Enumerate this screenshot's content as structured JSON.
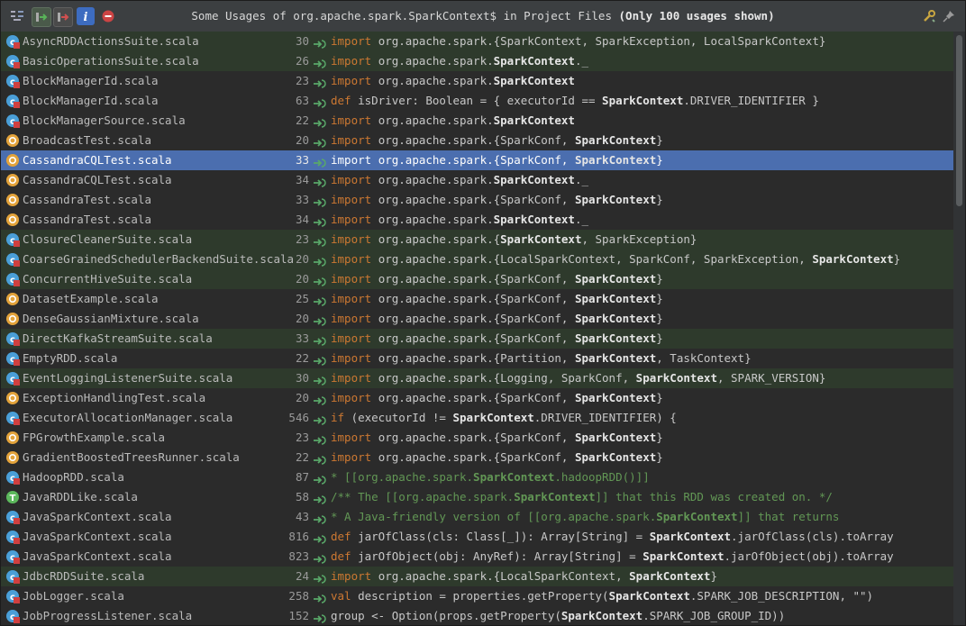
{
  "title": {
    "prefix": "Some Usages of org.apache.spark.SparkContext$ in Project Files ",
    "suffix": "(Only 100 usages shown)"
  },
  "toolbar": {
    "buttons": [
      {
        "name": "merge-usages-icon",
        "icon": "merge"
      },
      {
        "name": "next-occurrence-icon",
        "icon": "arrow-right-green"
      },
      {
        "name": "previous-occurrence-icon",
        "icon": "arrow-right-red"
      },
      {
        "name": "info-icon",
        "icon": "info"
      },
      {
        "name": "close-icon",
        "icon": "stop"
      }
    ],
    "right": [
      {
        "name": "settings-icon",
        "icon": "wrench"
      },
      {
        "name": "pin-icon",
        "icon": "pin"
      }
    ]
  },
  "rows": [
    {
      "file": "AsyncRDDActionsSuite.scala",
      "line": "30",
      "type": "class",
      "test": true,
      "code": [
        [
          "kw",
          "import "
        ],
        [
          "",
          "org.apache.spark.{SparkContext, SparkException, LocalSparkContext}"
        ]
      ]
    },
    {
      "file": "BasicOperationsSuite.scala",
      "line": "26",
      "type": "class",
      "test": true,
      "code": [
        [
          "kw",
          "import "
        ],
        [
          "",
          "org.apache.spark."
        ],
        [
          "hl",
          "SparkContext"
        ],
        [
          "",
          "._"
        ]
      ]
    },
    {
      "file": "BlockManagerId.scala",
      "line": "23",
      "type": "class",
      "code": [
        [
          "kw",
          "import "
        ],
        [
          "",
          "org.apache.spark."
        ],
        [
          "hl",
          "SparkContext"
        ]
      ]
    },
    {
      "file": "BlockManagerId.scala",
      "line": "63",
      "type": "class",
      "code": [
        [
          "kw",
          "def "
        ],
        [
          "",
          "isDriver: Boolean = { executorId == "
        ],
        [
          "hl",
          "SparkContext"
        ],
        [
          "",
          ".DRIVER_IDENTIFIER }"
        ]
      ]
    },
    {
      "file": "BlockManagerSource.scala",
      "line": "22",
      "type": "class",
      "code": [
        [
          "kw",
          "import "
        ],
        [
          "",
          "org.apache.spark."
        ],
        [
          "hl",
          "SparkContext"
        ]
      ]
    },
    {
      "file": "BroadcastTest.scala",
      "line": "20",
      "type": "object",
      "code": [
        [
          "kw",
          "import "
        ],
        [
          "",
          "org.apache.spark.{SparkConf, "
        ],
        [
          "hl",
          "SparkContext"
        ],
        [
          "",
          "}"
        ]
      ]
    },
    {
      "file": "CassandraCQLTest.scala",
      "line": "33",
      "type": "object",
      "selected": true,
      "code": [
        [
          "kw",
          "import "
        ],
        [
          "",
          "org.apache.spark.{SparkConf, "
        ],
        [
          "hl",
          "SparkContext"
        ],
        [
          "",
          "}"
        ]
      ]
    },
    {
      "file": "CassandraCQLTest.scala",
      "line": "34",
      "type": "object",
      "code": [
        [
          "kw",
          "import "
        ],
        [
          "",
          "org.apache.spark."
        ],
        [
          "hl",
          "SparkContext"
        ],
        [
          "",
          "._"
        ]
      ]
    },
    {
      "file": "CassandraTest.scala",
      "line": "33",
      "type": "object",
      "code": [
        [
          "kw",
          "import "
        ],
        [
          "",
          "org.apache.spark.{SparkConf, "
        ],
        [
          "hl",
          "SparkContext"
        ],
        [
          "",
          "}"
        ]
      ]
    },
    {
      "file": "CassandraTest.scala",
      "line": "34",
      "type": "object",
      "code": [
        [
          "kw",
          "import "
        ],
        [
          "",
          "org.apache.spark."
        ],
        [
          "hl",
          "SparkContext"
        ],
        [
          "",
          "._"
        ]
      ]
    },
    {
      "file": "ClosureCleanerSuite.scala",
      "line": "23",
      "type": "class",
      "test": true,
      "code": [
        [
          "kw",
          "import "
        ],
        [
          "",
          "org.apache.spark.{"
        ],
        [
          "hl",
          "SparkContext"
        ],
        [
          "",
          ", SparkException}"
        ]
      ]
    },
    {
      "file": "CoarseGrainedSchedulerBackendSuite.scala",
      "line": "20",
      "type": "class",
      "test": true,
      "code": [
        [
          "kw",
          "import "
        ],
        [
          "",
          "org.apache.spark.{LocalSparkContext, SparkConf, SparkException, "
        ],
        [
          "hl",
          "SparkContext"
        ],
        [
          "",
          "}"
        ]
      ]
    },
    {
      "file": "ConcurrentHiveSuite.scala",
      "line": "20",
      "type": "class",
      "test": true,
      "code": [
        [
          "kw",
          "import "
        ],
        [
          "",
          "org.apache.spark.{SparkConf, "
        ],
        [
          "hl",
          "SparkContext"
        ],
        [
          "",
          "}"
        ]
      ]
    },
    {
      "file": "DatasetExample.scala",
      "line": "25",
      "type": "object",
      "code": [
        [
          "kw",
          "import "
        ],
        [
          "",
          "org.apache.spark.{SparkConf, "
        ],
        [
          "hl",
          "SparkContext"
        ],
        [
          "",
          "}"
        ]
      ]
    },
    {
      "file": "DenseGaussianMixture.scala",
      "line": "20",
      "type": "object",
      "code": [
        [
          "kw",
          "import "
        ],
        [
          "",
          "org.apache.spark.{SparkConf, "
        ],
        [
          "hl",
          "SparkContext"
        ],
        [
          "",
          "}"
        ]
      ]
    },
    {
      "file": "DirectKafkaStreamSuite.scala",
      "line": "33",
      "type": "class",
      "test": true,
      "code": [
        [
          "kw",
          "import "
        ],
        [
          "",
          "org.apache.spark.{SparkConf, "
        ],
        [
          "hl",
          "SparkContext"
        ],
        [
          "",
          "}"
        ]
      ]
    },
    {
      "file": "EmptyRDD.scala",
      "line": "22",
      "type": "class",
      "code": [
        [
          "kw",
          "import "
        ],
        [
          "",
          "org.apache.spark.{Partition, "
        ],
        [
          "hl",
          "SparkContext"
        ],
        [
          "",
          ", TaskContext}"
        ]
      ]
    },
    {
      "file": "EventLoggingListenerSuite.scala",
      "line": "30",
      "type": "class",
      "test": true,
      "code": [
        [
          "kw",
          "import "
        ],
        [
          "",
          "org.apache.spark.{Logging, SparkConf, "
        ],
        [
          "hl",
          "SparkContext"
        ],
        [
          "",
          ", SPARK_VERSION}"
        ]
      ]
    },
    {
      "file": "ExceptionHandlingTest.scala",
      "line": "20",
      "type": "object",
      "code": [
        [
          "kw",
          "import "
        ],
        [
          "",
          "org.apache.spark.{SparkConf, "
        ],
        [
          "hl",
          "SparkContext"
        ],
        [
          "",
          "}"
        ]
      ]
    },
    {
      "file": "ExecutorAllocationManager.scala",
      "line": "546",
      "type": "class",
      "code": [
        [
          "kw",
          "if "
        ],
        [
          "",
          "(executorId != "
        ],
        [
          "hl",
          "SparkContext"
        ],
        [
          "",
          ".DRIVER_IDENTIFIER) {"
        ]
      ]
    },
    {
      "file": "FPGrowthExample.scala",
      "line": "23",
      "type": "object",
      "code": [
        [
          "kw",
          "import "
        ],
        [
          "",
          "org.apache.spark.{SparkConf, "
        ],
        [
          "hl",
          "SparkContext"
        ],
        [
          "",
          "}"
        ]
      ]
    },
    {
      "file": "GradientBoostedTreesRunner.scala",
      "line": "22",
      "type": "object",
      "code": [
        [
          "kw",
          "import "
        ],
        [
          "",
          "org.apache.spark.{SparkConf, "
        ],
        [
          "hl",
          "SparkContext"
        ],
        [
          "",
          "}"
        ]
      ]
    },
    {
      "file": "HadoopRDD.scala",
      "line": "87",
      "type": "class",
      "code": [
        [
          "cm",
          " * [[org.apache.spark."
        ],
        [
          "cmhl",
          "SparkContext"
        ],
        [
          "cm",
          ".hadoopRDD()]]"
        ]
      ]
    },
    {
      "file": "JavaRDDLike.scala",
      "line": "58",
      "type": "trait",
      "code": [
        [
          "cm",
          "/** The [[org.apache.spark."
        ],
        [
          "cmhl",
          "SparkContext"
        ],
        [
          "cm",
          "]] that this RDD was created on. */"
        ]
      ]
    },
    {
      "file": "JavaSparkContext.scala",
      "line": "43",
      "type": "class",
      "code": [
        [
          "cm",
          " * A Java-friendly version of [[org.apache.spark."
        ],
        [
          "cmhl",
          "SparkContext"
        ],
        [
          "cm",
          "]] that returns"
        ]
      ]
    },
    {
      "file": "JavaSparkContext.scala",
      "line": "816",
      "type": "class",
      "code": [
        [
          "kw",
          "def "
        ],
        [
          "",
          "jarOfClass(cls: Class[_]): Array[String] = "
        ],
        [
          "hl",
          "SparkContext"
        ],
        [
          "",
          ".jarOfClass(cls).toArray"
        ]
      ]
    },
    {
      "file": "JavaSparkContext.scala",
      "line": "823",
      "type": "class",
      "code": [
        [
          "kw",
          "def "
        ],
        [
          "",
          "jarOfObject(obj: AnyRef): Array[String] = "
        ],
        [
          "hl",
          "SparkContext"
        ],
        [
          "",
          ".jarOfObject(obj).toArray"
        ]
      ]
    },
    {
      "file": "JdbcRDDSuite.scala",
      "line": "24",
      "type": "class",
      "test": true,
      "code": [
        [
          "kw",
          "import "
        ],
        [
          "",
          "org.apache.spark.{LocalSparkContext, "
        ],
        [
          "hl",
          "SparkContext"
        ],
        [
          "",
          "}"
        ]
      ]
    },
    {
      "file": "JobLogger.scala",
      "line": "258",
      "type": "class",
      "code": [
        [
          "kw",
          "val "
        ],
        [
          "",
          "description = properties.getProperty("
        ],
        [
          "hl",
          "SparkContext"
        ],
        [
          "",
          ".SPARK_JOB_DESCRIPTION, \"\")"
        ]
      ]
    },
    {
      "file": "JobProgressListener.scala",
      "line": "152",
      "type": "class",
      "code": [
        [
          "",
          "group <- Option(props.getProperty("
        ],
        [
          "hl",
          "SparkContext"
        ],
        [
          "",
          ".SPARK_JOB_GROUP_ID))"
        ]
      ]
    }
  ]
}
